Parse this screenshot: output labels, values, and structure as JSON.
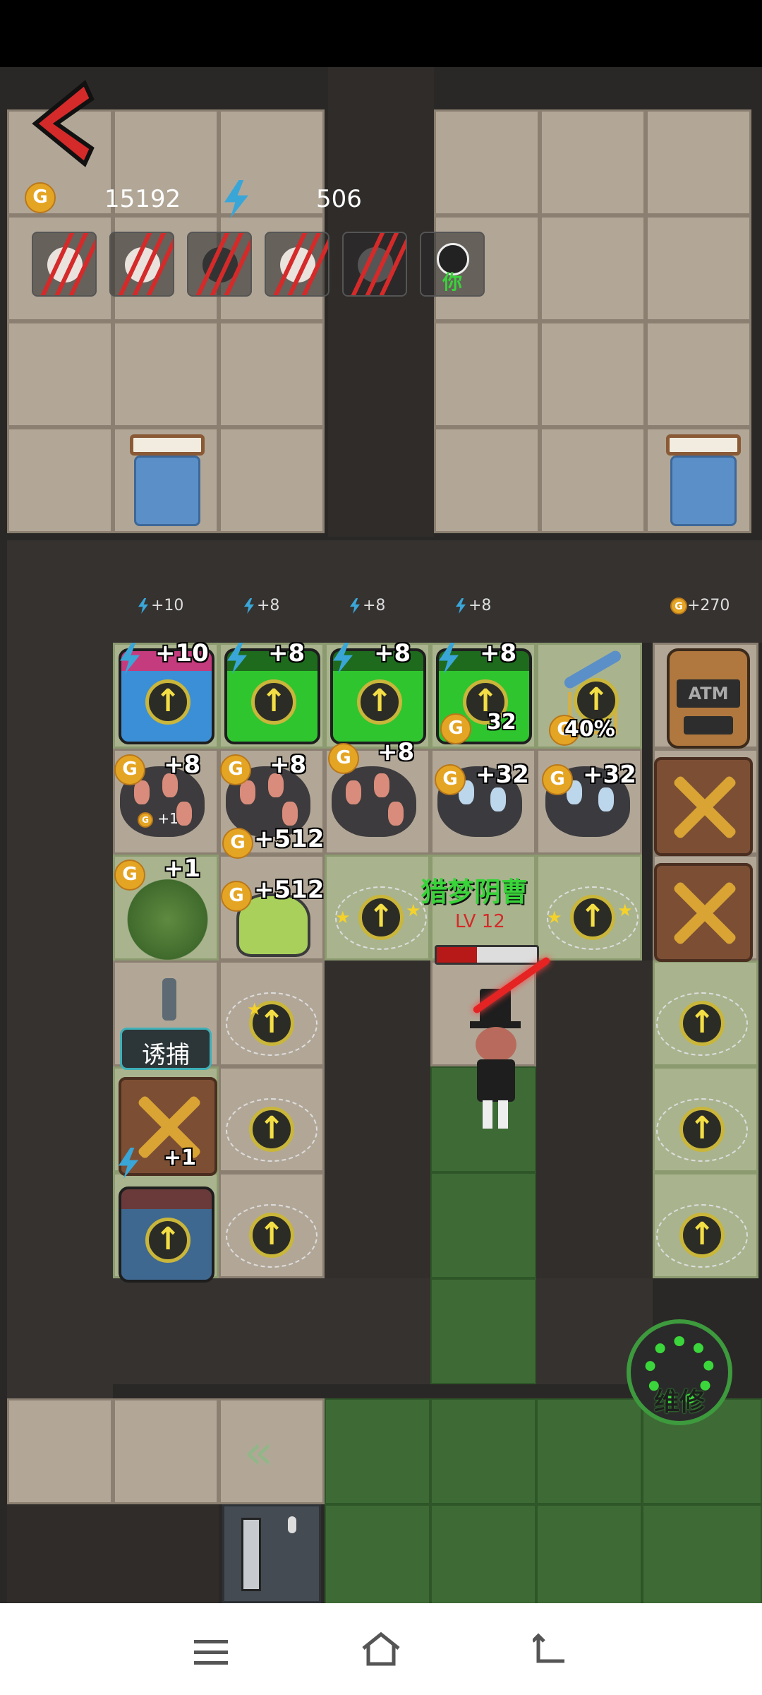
{
  "hud": {
    "back_icon": "back-chevron-icon",
    "coins_value": "15192",
    "energy_value": "506",
    "coin_symbol": "G"
  },
  "players": [
    {
      "name": "player-1",
      "defeated": true,
      "tag": ""
    },
    {
      "name": "player-2",
      "defeated": true,
      "tag": ""
    },
    {
      "name": "player-3",
      "defeated": true,
      "tag": ""
    },
    {
      "name": "player-4",
      "defeated": true,
      "tag": ""
    },
    {
      "name": "player-5",
      "defeated": true,
      "tag": ""
    },
    {
      "name": "player-you",
      "defeated": false,
      "tag": "你"
    }
  ],
  "income_row": [
    {
      "type": "energy",
      "label": "+10"
    },
    {
      "type": "energy",
      "label": "+8"
    },
    {
      "type": "energy",
      "label": "+8"
    },
    {
      "type": "energy",
      "label": "+8"
    },
    {
      "type": "none",
      "label": ""
    },
    {
      "type": "coin",
      "label": "+270"
    }
  ],
  "grid": {
    "row1": {
      "labels": [
        "+10",
        "+8",
        "+8",
        "+8"
      ],
      "obscured_labels": [
        "32",
        "40%"
      ],
      "atm_label": "ATM"
    },
    "row2": {
      "labels": [
        "+8",
        "+8",
        "+8",
        "+32",
        "+32"
      ],
      "small_label": "+1",
      "overlay_label": "+512"
    },
    "row3": {
      "labels": [
        "+1",
        "+512"
      ],
      "enemy_name": "猎梦阴曹",
      "enemy_level": "LV 12",
      "enemy_hp_fraction": 0.4
    },
    "row4": {
      "lure_label": "诱捕"
    },
    "row5": {
      "label": "+1"
    }
  },
  "repair_button": {
    "label": "维修",
    "icon": "gear-wrench-icon"
  },
  "system_nav": {
    "menu_icon": "menu-icon",
    "home_icon": "home-icon",
    "back_icon": "back-icon"
  },
  "colors": {
    "floor": "#b2a797",
    "grass": "#3e6b35",
    "wall": "#2a2826",
    "accent_red": "#d52a2a",
    "coin": "#e5a524",
    "energy": "#3aa6d8",
    "enemy_name": "#39d33a"
  }
}
